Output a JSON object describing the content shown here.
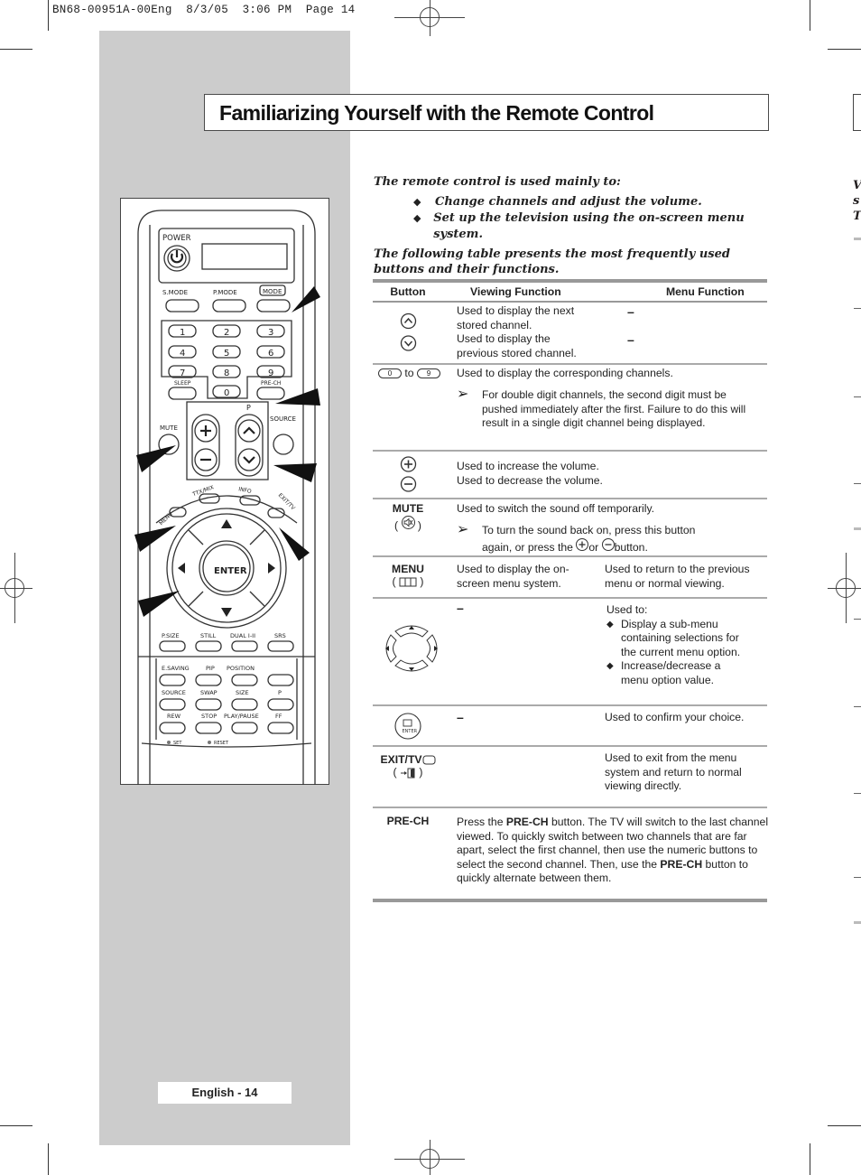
{
  "print_slug": "BN68-00951A-00Eng  8/3/05  3:06 PM  Page 14",
  "title": "Familiarizing Yourself with the Remote Control",
  "intro": {
    "lead": "The remote control is used mainly to:",
    "bullets": [
      "Change channels and adjust the volume.",
      "Set up the television using the on-screen menu system."
    ],
    "lead2": "The following table presents the most frequently used buttons and their functions.",
    "bullet_glyph": "◆"
  },
  "table": {
    "headers": {
      "button": "Button",
      "viewing": "Viewing Function",
      "menu": "Menu Function"
    },
    "rows": {
      "channel_updown": {
        "button_icons": [
          "chevron-up-icon",
          "chevron-down-icon"
        ],
        "view_up": "Used to display the next stored channel.",
        "view_down": "Used to display the previous stored channel.",
        "menu_up": "–",
        "menu_down": "–"
      },
      "number_keys": {
        "key_from": "0",
        "to": "to",
        "key_to": "9",
        "view": "Used to display the corresponding channels.",
        "note": "For double digit channels, the second digit must be pushed immediately after the first. Failure to do this will result in a single digit channel being displayed."
      },
      "volume": {
        "view_up": "Used to increase the volume.",
        "view_down": "Used to decrease the volume."
      },
      "mute": {
        "label": "MUTE",
        "view": "Used to switch the sound off temporarily.",
        "note_a": "To turn the sound back on, press this button again, or press the",
        "note_or": "or",
        "note_b": "button."
      },
      "menu": {
        "label": "MENU",
        "view": "Used to display the on-screen menu system.",
        "menu": "Used to return to the previous menu or normal viewing."
      },
      "arrows": {
        "view": "–",
        "menu_intro": "Used to:",
        "menu_bullets": [
          "Display a sub-menu containing selections for the current menu option.",
          "Increase/decrease a menu option value."
        ]
      },
      "enter": {
        "view": "–",
        "menu": "Used to confirm your choice.",
        "icon_text": "ENTER"
      },
      "exit": {
        "label": "EXIT/TV",
        "menu": "Used to exit from the menu system and return to normal viewing directly."
      },
      "prech": {
        "label": "PRE-CH",
        "t1": "Press the ",
        "b1": "PRE-CH",
        "t2": " button. The TV will switch to the last channel viewed. To quickly switch between two channels that are far apart, select the first channel, then use the numeric buttons to select the second channel. Then, use the ",
        "b2": "PRE-CH",
        "t3": " button to quickly alternate between them."
      }
    }
  },
  "note_glyph": "➢",
  "page_label": "English - 14",
  "remote": {
    "power": "POWER",
    "smode": "S.MODE",
    "pmode": "P.MODE",
    "mode": "MODE",
    "digits": [
      "1",
      "2",
      "3",
      "4",
      "5",
      "6",
      "7",
      "8",
      "9",
      "0"
    ],
    "sleep": "SLEEP",
    "prech": "PRE-CH",
    "mute": "MUTE",
    "p": "P",
    "source": "SOURCE",
    "menu": "MENU",
    "ttx": "TTX/MIX",
    "info": "INFO",
    "exit": "EXIT/TV",
    "enter": "ENTER",
    "row1": [
      "P.SIZE",
      "STILL",
      "DUAL I-II",
      "SRS"
    ],
    "row2": [
      "E.SAVING",
      "PIP",
      "POSITION",
      ""
    ],
    "row3": [
      "SOURCE",
      "SWAP",
      "SIZE",
      "P"
    ],
    "row4": [
      "REW",
      "STOP",
      "PLAY/PAUSE",
      "FF"
    ],
    "set": "SET",
    "reset": "RESET"
  },
  "edge_text": [
    "V",
    "s",
    "T"
  ],
  "colors": {
    "panel_gray": "#cccccc",
    "rule_gray": "#999999",
    "text": "#231f20"
  }
}
